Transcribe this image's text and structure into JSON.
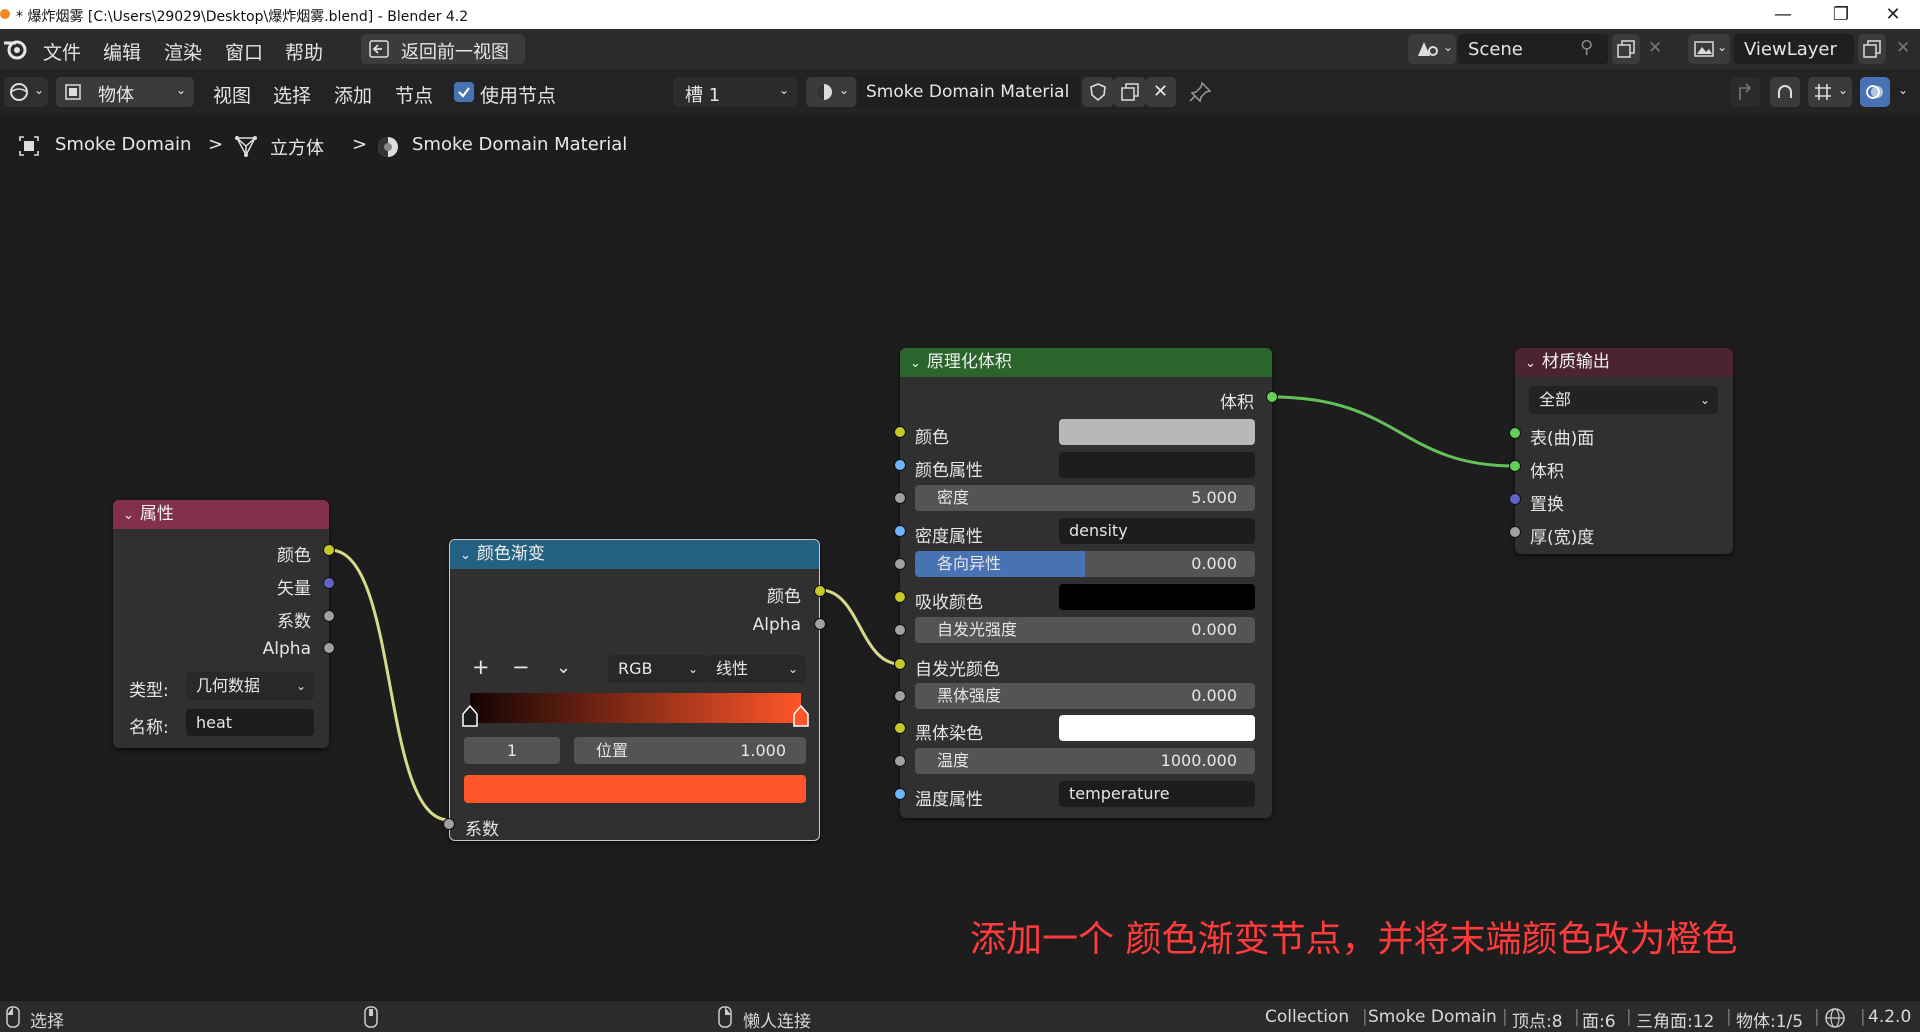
{
  "window": {
    "title": "* 爆炸烟雾 [C:\\Users\\29029\\Desktop\\爆炸烟雾.blend] - Blender 4.2",
    "minimize": "—",
    "maximize": "❐",
    "close": "✕"
  },
  "menubar": {
    "file": "文件",
    "edit": "编辑",
    "render": "渲染",
    "window": "窗口",
    "help": "帮助",
    "back_view": "返回前一视图",
    "scene": "Scene",
    "view_layer": "ViewLayer"
  },
  "header": {
    "mode": "物体",
    "view": "视图",
    "select": "选择",
    "add": "添加",
    "node": "节点",
    "use_nodes": "使用节点",
    "slot": "槽 1",
    "material": "Smoke Domain Material"
  },
  "breadcrumb": {
    "object": "Smoke Domain",
    "mesh": "立方体",
    "material": "Smoke Domain Material",
    "separator": ">"
  },
  "nodes": {
    "attribute": {
      "title": "属性",
      "outputs": [
        "颜色",
        "矢量",
        "系数",
        "Alpha"
      ],
      "type_label": "类型:",
      "type_value": "几何数据",
      "name_label": "名称:",
      "name_value": "heat"
    },
    "color_ramp": {
      "title": "颜色渐变",
      "out_color": "颜色",
      "out_alpha": "Alpha",
      "add": "+",
      "remove": "−",
      "menu": "⌄",
      "color_mode": "RGB",
      "interpolation": "线性",
      "stop_index": "1",
      "position_label": "位置",
      "position_value": "1.000",
      "end_color": "#ff5529",
      "in_fac": "系数"
    },
    "principled_volume": {
      "title": "原理化体积",
      "out_volume": "体积",
      "color": "颜色",
      "color_attr": "颜色属性",
      "density": "密度",
      "density_value": "5.000",
      "density_attr": "密度属性",
      "density_attr_value": "density",
      "anisotropy": "各向异性",
      "anisotropy_value": "0.000",
      "absorption_color": "吸收颜色",
      "emission_strength": "自发光强度",
      "emission_strength_value": "0.000",
      "emission_color": "自发光颜色",
      "blackbody_intensity": "黑体强度",
      "blackbody_intensity_value": "0.000",
      "blackbody_tint": "黑体染色",
      "temperature": "温度",
      "temperature_value": "1000.000",
      "temperature_attr": "温度属性",
      "temperature_attr_value": "temperature"
    },
    "material_output": {
      "title": "材质输出",
      "target": "全部",
      "surface": "表(曲)面",
      "volume": "体积",
      "displacement": "置换",
      "thickness": "厚(宽)度"
    }
  },
  "annotation": "添加一个 颜色渐变节点，并将末端颜色改为橙色",
  "statusbar": {
    "select": "选择",
    "lazy_connect": "懒人连接",
    "collection": "Collection",
    "object": "Smoke Domain",
    "verts": "顶点:8",
    "faces": "面:6",
    "tris": "三角面:12",
    "objects": "物体:1/5",
    "version": "4.2.0"
  },
  "colors": {
    "attribute_header": "#83314a",
    "color_ramp_header": "#246283",
    "principled_header": "#2b652b",
    "output_header": "#4b2430",
    "accent_blue": "#4772b3"
  }
}
